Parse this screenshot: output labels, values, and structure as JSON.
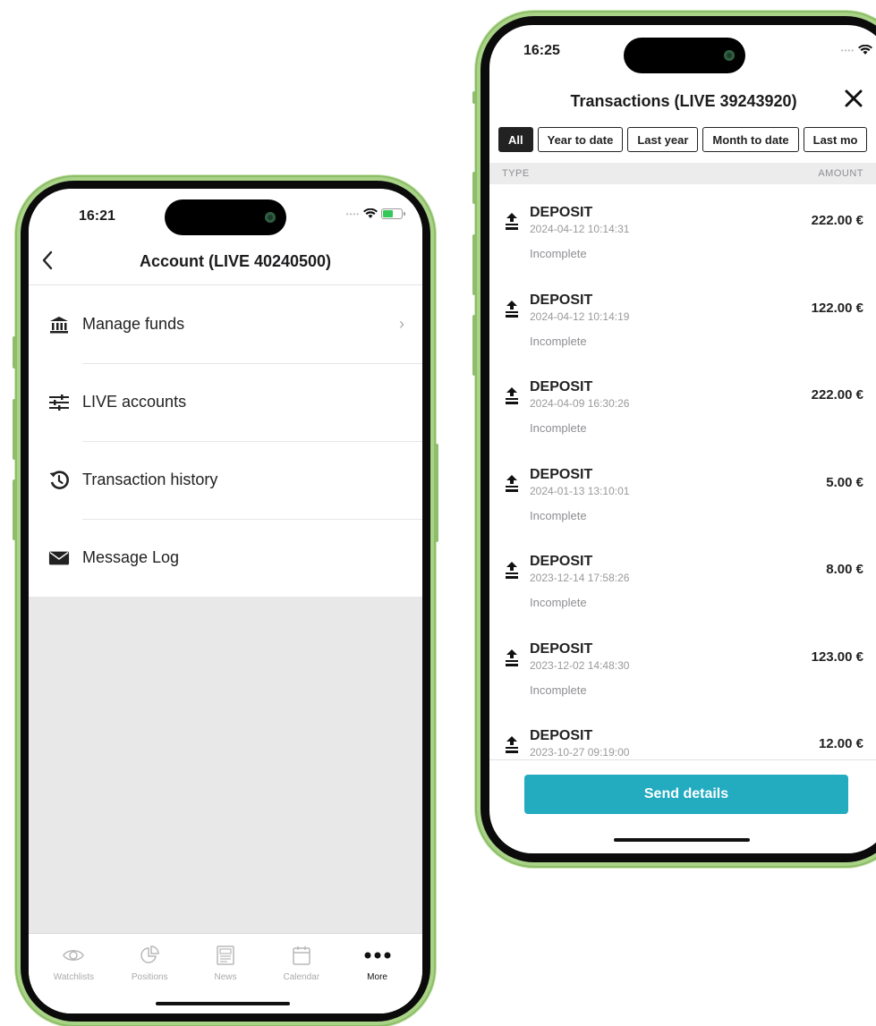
{
  "colors": {
    "phone_frame": "#a9d387",
    "accent": "#23abc0",
    "active_chip": "#222222"
  },
  "phone_left": {
    "status": {
      "time": "16:21"
    },
    "header": {
      "back_icon": "chevron-left-icon",
      "title": "Account (LIVE 40240500)"
    },
    "menu": [
      {
        "icon": "bank-icon",
        "label": "Manage funds",
        "chevron": "›"
      },
      {
        "icon": "sliders-icon",
        "label": "LIVE accounts"
      },
      {
        "icon": "history-icon",
        "label": "Transaction history"
      },
      {
        "icon": "envelope-icon",
        "label": "Message Log"
      }
    ],
    "tabbar": [
      {
        "icon": "eye-icon",
        "label": "Watchlists"
      },
      {
        "icon": "pie-chart-icon",
        "label": "Positions"
      },
      {
        "icon": "newspaper-icon",
        "label": "News"
      },
      {
        "icon": "calendar-icon",
        "label": "Calendar"
      },
      {
        "icon": "more-dots-icon",
        "label": "More",
        "active": true
      }
    ]
  },
  "phone_right": {
    "status": {
      "time": "16:25"
    },
    "header": {
      "title": "Transactions (LIVE 39243920)",
      "close_icon": "close-icon"
    },
    "filters": [
      "All",
      "Year to date",
      "Last year",
      "Month to date",
      "Last mo"
    ],
    "active_filter": "All",
    "columns": {
      "type": "TYPE",
      "amount": "AMOUNT"
    },
    "transactions": [
      {
        "type": "DEPOSIT",
        "date": "2024-04-12 10:14:31",
        "status": "Incomplete",
        "amount": "222.00 €"
      },
      {
        "type": "DEPOSIT",
        "date": "2024-04-12 10:14:19",
        "status": "Incomplete",
        "amount": "122.00 €"
      },
      {
        "type": "DEPOSIT",
        "date": "2024-04-09 16:30:26",
        "status": "Incomplete",
        "amount": "222.00 €"
      },
      {
        "type": "DEPOSIT",
        "date": "2024-01-13 13:10:01",
        "status": "Incomplete",
        "amount": "5.00 €"
      },
      {
        "type": "DEPOSIT",
        "date": "2023-12-14 17:58:26",
        "status": "Incomplete",
        "amount": "8.00 €"
      },
      {
        "type": "DEPOSIT",
        "date": "2023-12-02 14:48:30",
        "status": "Incomplete",
        "amount": "123.00 €"
      },
      {
        "type": "DEPOSIT",
        "date": "2023-10-27 09:19:00",
        "status": "",
        "amount": "12.00 €"
      }
    ],
    "send_button": "Send details"
  }
}
